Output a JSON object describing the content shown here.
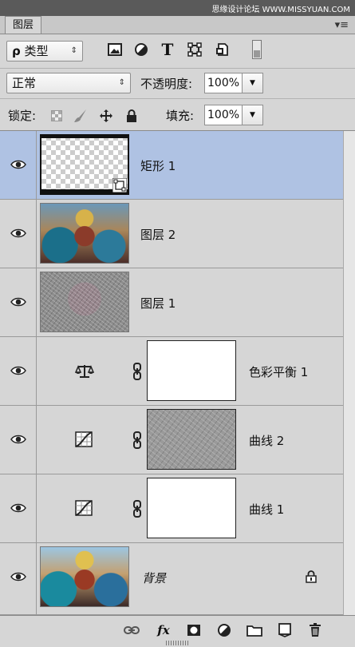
{
  "watermark": "思缘设计论坛 WWW.MISSYUAN.COM",
  "collapse_glyph": "◂◂",
  "panel": {
    "tab_label": "图层",
    "menu_glyph": "▾≡"
  },
  "filter": {
    "search_glyph": "ρ",
    "label": "类型",
    "arrow": "⇕"
  },
  "filter_icons": [
    "image-icon",
    "adjustment-icon",
    "text-icon",
    "shape-icon",
    "smart-object-icon",
    "filter-toggle-icon"
  ],
  "blend": {
    "mode": "正常",
    "arrow": "⇕",
    "opacity_label": "不透明度:",
    "opacity_value": "100%"
  },
  "lock": {
    "label": "锁定:",
    "fill_label": "填充:",
    "fill_value": "100%"
  },
  "dropdown_arrow": "▼",
  "layers": [
    {
      "name": "矩形 1",
      "kind": "shape",
      "selected": true
    },
    {
      "name": "图层 2",
      "kind": "photo"
    },
    {
      "name": "图层 1",
      "kind": "noise"
    },
    {
      "name": "色彩平衡 1",
      "kind": "adjustment",
      "adj_icon": "color-balance-icon"
    },
    {
      "name": "曲线 2",
      "kind": "adjustment",
      "adj_icon": "curves-icon"
    },
    {
      "name": "曲线 1",
      "kind": "adjustment",
      "adj_icon": "curves-icon"
    },
    {
      "name": "背景",
      "kind": "background",
      "locked": true
    }
  ],
  "bottom_bar": {
    "fx_label": "fx"
  },
  "colors": {
    "selection": "#afc2e3",
    "panel": "#d6d6d6"
  }
}
